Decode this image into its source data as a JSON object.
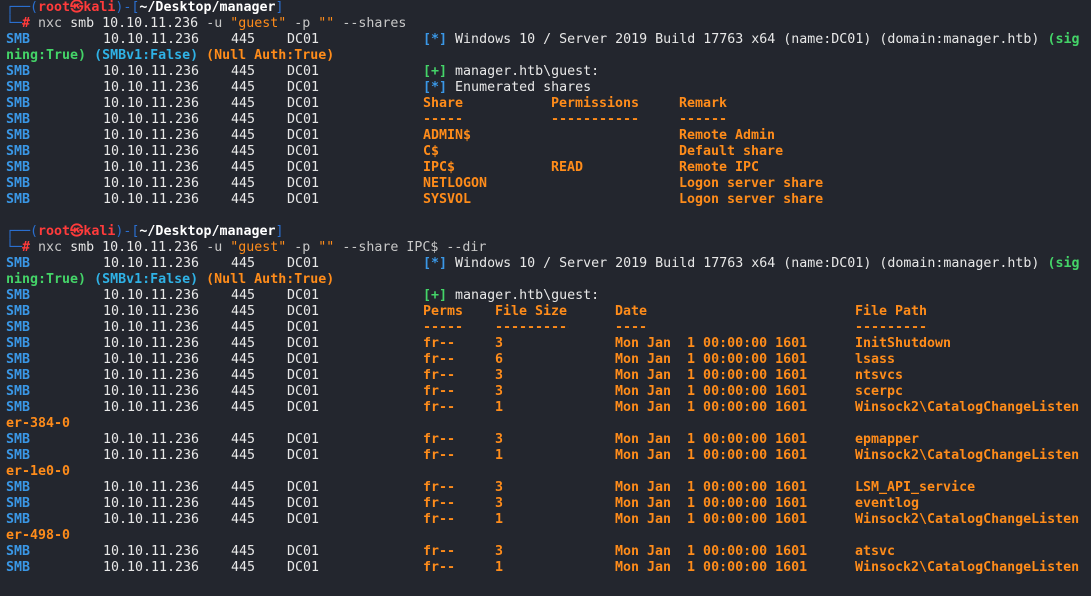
{
  "prompt_1": {
    "user": "root",
    "at_symbol": "㉿",
    "host": "kali",
    "cwd": "~/Desktop/manager",
    "hash": "#",
    "command_parts": [
      {
        "text": "nxc",
        "cls": "grey"
      },
      {
        "text": " smb 10.10.11.236 ",
        "cls": "white"
      },
      {
        "text": "-u",
        "cls": "grey"
      },
      {
        "text": " ",
        "cls": "white"
      },
      {
        "text": "\"guest\"",
        "cls": "orange_plain"
      },
      {
        "text": " -p ",
        "cls": "grey"
      },
      {
        "text": "\"\"",
        "cls": "orange_plain"
      },
      {
        "text": " --shares",
        "cls": "grey"
      }
    ]
  },
  "prompt_2": {
    "user": "root",
    "at_symbol": "㉿",
    "host": "kali",
    "cwd": "~/Desktop/manager",
    "hash": "#",
    "command_parts": [
      {
        "text": "nxc",
        "cls": "grey"
      },
      {
        "text": " smb 10.10.11.236 ",
        "cls": "white"
      },
      {
        "text": "-u",
        "cls": "grey"
      },
      {
        "text": " ",
        "cls": "white"
      },
      {
        "text": "\"guest\"",
        "cls": "orange_plain"
      },
      {
        "text": " -p ",
        "cls": "grey"
      },
      {
        "text": "\"\"",
        "cls": "orange_plain"
      },
      {
        "text": " --share IPC$ --dir",
        "cls": "grey"
      }
    ]
  },
  "smb": {
    "proto": "SMB",
    "ip": "10.10.11.236",
    "port": "445",
    "host": "DC01"
  },
  "info_1": {
    "tag": "[*]",
    "text_a": "Windows 10 / Server 2019 Build 17763 x64 (name:DC01) (domain:manager.htb) ",
    "text_b": "(sig",
    "wrap_a": "ning:True)",
    "wrap_b": " (SMBv1:False)",
    "wrap_c": " (Null Auth:True)"
  },
  "auth_1": {
    "tag": "[+]",
    "text": "manager.htb\\guest:"
  },
  "enum": {
    "tag": "[*]",
    "text": "Enumerated shares"
  },
  "shares_headers": {
    "share": "Share",
    "perms": "Permissions",
    "remark": "Remark"
  },
  "shares_underlines": {
    "share": "-----",
    "perms": "-----------",
    "remark": "------"
  },
  "shares": [
    {
      "name": "ADMIN$",
      "perms": "",
      "remark": "Remote Admin"
    },
    {
      "name": "C$",
      "perms": "",
      "remark": "Default share"
    },
    {
      "name": "IPC$",
      "perms": "READ",
      "remark": "Remote IPC"
    },
    {
      "name": "NETLOGON",
      "perms": "",
      "remark": "Logon server share"
    },
    {
      "name": "SYSVOL",
      "perms": "",
      "remark": "Logon server share"
    }
  ],
  "info_2": {
    "tag": "[*]",
    "text_a": "Windows 10 / Server 2019 Build 17763 x64 (name:DC01) (domain:manager.htb) ",
    "text_b": "(sig",
    "wrap_a": "ning:True)",
    "wrap_b": " (SMBv1:False)",
    "wrap_c": " (Null Auth:True)"
  },
  "auth_2": {
    "tag": "[+]",
    "text": "manager.htb\\guest:"
  },
  "dir_headers": {
    "perms": "Perms",
    "size": "File Size",
    "date": "Date",
    "path": "File Path"
  },
  "dir_underlines": {
    "perms": "-----",
    "size": "---------",
    "date": "----",
    "path": "---------"
  },
  "files": [
    {
      "perms": "fr--",
      "size": "3",
      "date": "Mon Jan  1 00:00:00 1601",
      "path": "InitShutdown",
      "wrap": ""
    },
    {
      "perms": "fr--",
      "size": "6",
      "date": "Mon Jan  1 00:00:00 1601",
      "path": "lsass",
      "wrap": ""
    },
    {
      "perms": "fr--",
      "size": "3",
      "date": "Mon Jan  1 00:00:00 1601",
      "path": "ntsvcs",
      "wrap": ""
    },
    {
      "perms": "fr--",
      "size": "3",
      "date": "Mon Jan  1 00:00:00 1601",
      "path": "scerpc",
      "wrap": ""
    },
    {
      "perms": "fr--",
      "size": "1",
      "date": "Mon Jan  1 00:00:00 1601",
      "path": "Winsock2\\CatalogChangeListen",
      "wrap": "er-384-0"
    },
    {
      "perms": "fr--",
      "size": "3",
      "date": "Mon Jan  1 00:00:00 1601",
      "path": "epmapper",
      "wrap": ""
    },
    {
      "perms": "fr--",
      "size": "1",
      "date": "Mon Jan  1 00:00:00 1601",
      "path": "Winsock2\\CatalogChangeListen",
      "wrap": "er-1e0-0"
    },
    {
      "perms": "fr--",
      "size": "3",
      "date": "Mon Jan  1 00:00:00 1601",
      "path": "LSM_API_service",
      "wrap": ""
    },
    {
      "perms": "fr--",
      "size": "3",
      "date": "Mon Jan  1 00:00:00 1601",
      "path": "eventlog",
      "wrap": ""
    },
    {
      "perms": "fr--",
      "size": "1",
      "date": "Mon Jan  1 00:00:00 1601",
      "path": "Winsock2\\CatalogChangeListen",
      "wrap": "er-498-0"
    },
    {
      "perms": "fr--",
      "size": "3",
      "date": "Mon Jan  1 00:00:00 1601",
      "path": "atsvc",
      "wrap": ""
    },
    {
      "perms": "fr--",
      "size": "1",
      "date": "Mon Jan  1 00:00:00 1601",
      "path": "Winsock2\\CatalogChangeListen",
      "wrap": ""
    }
  ],
  "colors": {
    "background": "#23262e",
    "smb_blue": "#3a97e6",
    "orange": "#ff8c1a",
    "green": "#44d468",
    "red": "#ff3b3b"
  }
}
